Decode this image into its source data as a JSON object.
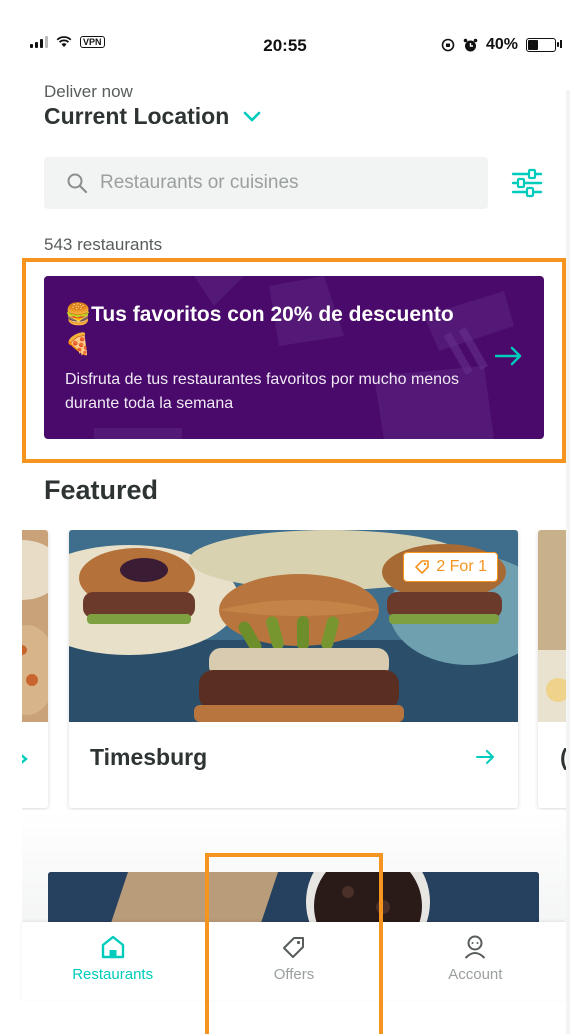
{
  "status_bar": {
    "time": "20:55",
    "vpn": "VPN",
    "battery": "40%",
    "battery_level": 0.4
  },
  "header": {
    "deliver_label": "Deliver now",
    "location": "Current Location"
  },
  "search": {
    "placeholder": "Restaurants or cuisines",
    "value": ""
  },
  "restaurant_count": "543 restaurants",
  "banner": {
    "title": "🍔Tus favoritos con 20% de descuento🍕",
    "subtitle": "Disfruta de tus restaurantes favoritos por mucho menos durante toda la semana"
  },
  "featured": {
    "title": "Featured",
    "cards": [
      {
        "name": "Timesburg",
        "badge": "2 For 1"
      }
    ]
  },
  "bottom_nav": {
    "items": [
      {
        "label": "Restaurants",
        "icon": "home-icon",
        "active": true
      },
      {
        "label": "Offers",
        "icon": "tag-icon",
        "active": false
      },
      {
        "label": "Account",
        "icon": "user-icon",
        "active": false
      }
    ]
  },
  "colors": {
    "accent": "#00ccbc",
    "banner_bg": "#4a0a6b",
    "highlight": "#f5941f",
    "text": "#2e3333",
    "muted": "#9a9f9f"
  }
}
